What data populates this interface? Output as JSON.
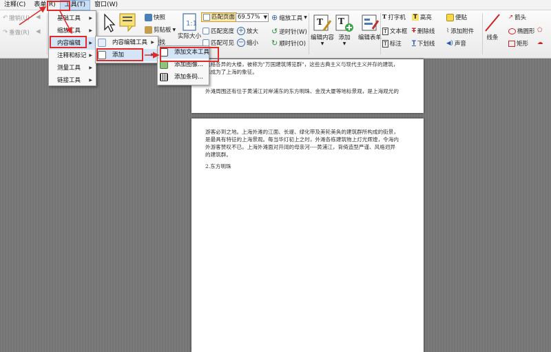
{
  "menubar": {
    "items": [
      "注释(C)",
      "表单(R)",
      "工具(T)",
      "窗口(W)"
    ]
  },
  "ribbon": {
    "undo": "撤销(U)",
    "redo": "重做(R)",
    "snapshot": "快照",
    "clipboard": "剪贴板",
    "find": "查找",
    "actual_size": "实际大小",
    "fit_page": "匹配页面",
    "fit_width": "匹配宽度",
    "fit_visible": "匹配可见",
    "zoom_value": "69.57%",
    "zoom_tool": "缩放工具",
    "zoom_in": "放大",
    "zoom_out": "缩小",
    "rotate_ccw": "逆时针(W)",
    "rotate_cw": "顺时针(O)",
    "edit_content": "编辑内容",
    "add": "添加",
    "edit_form": "编辑表单",
    "typewriter": "打字机",
    "textbox": "文本框",
    "callout": "标注",
    "highlight": "高亮",
    "strikeout": "删除线",
    "underline": "下划线",
    "note": "便贴",
    "attach": "添加附件",
    "sound": "声音",
    "line": "线条",
    "arrow": "箭头",
    "ellipse": "椭圆形",
    "rectangle": "矩形",
    "polygon": "多边"
  },
  "tools_menu": {
    "items": [
      "基础工具",
      "缩放工具",
      "内容编辑",
      "注释和标记",
      "测量工具",
      "链接工具"
    ]
  },
  "content_edit_menu": {
    "items": [
      "内容编辑工具",
      "添加"
    ]
  },
  "add_menu": {
    "items": [
      "添加文本工具",
      "添加图像...",
      "添加条码..."
    ]
  },
  "page1": {
    "line1": "风格各异的大楼，被称为\"万国建筑博览群\"，这些古典主义与现代主义并存的建筑，",
    "line2": "已成为了上海的象征。",
    "line3": "外滩周围还有位于黄浦江对岸浦东的东方明珠、金茂大厦等地标景观，是上海观光的"
  },
  "page2": {
    "line1": "游客必到之地。上海外滩的江面、长堤、绿化带及美轮美奂的建筑群所构成的街景，",
    "line2": "是最具有特征的上海景观。每当华灯初上之时，外滩各栋建筑物上灯光辉煌，令海内",
    "line3": "外游客赞叹不已。上海外滩面对开阔的母亲河----黄浦江，背倚造型严谨、风格迥异",
    "line4": "的建筑群。",
    "heading": "2.东方明珠"
  },
  "colors": {
    "accent_red": "#e02a2a",
    "menu_highlight": "#d4e5f8",
    "fit_page_bg": "#fde9b0"
  }
}
